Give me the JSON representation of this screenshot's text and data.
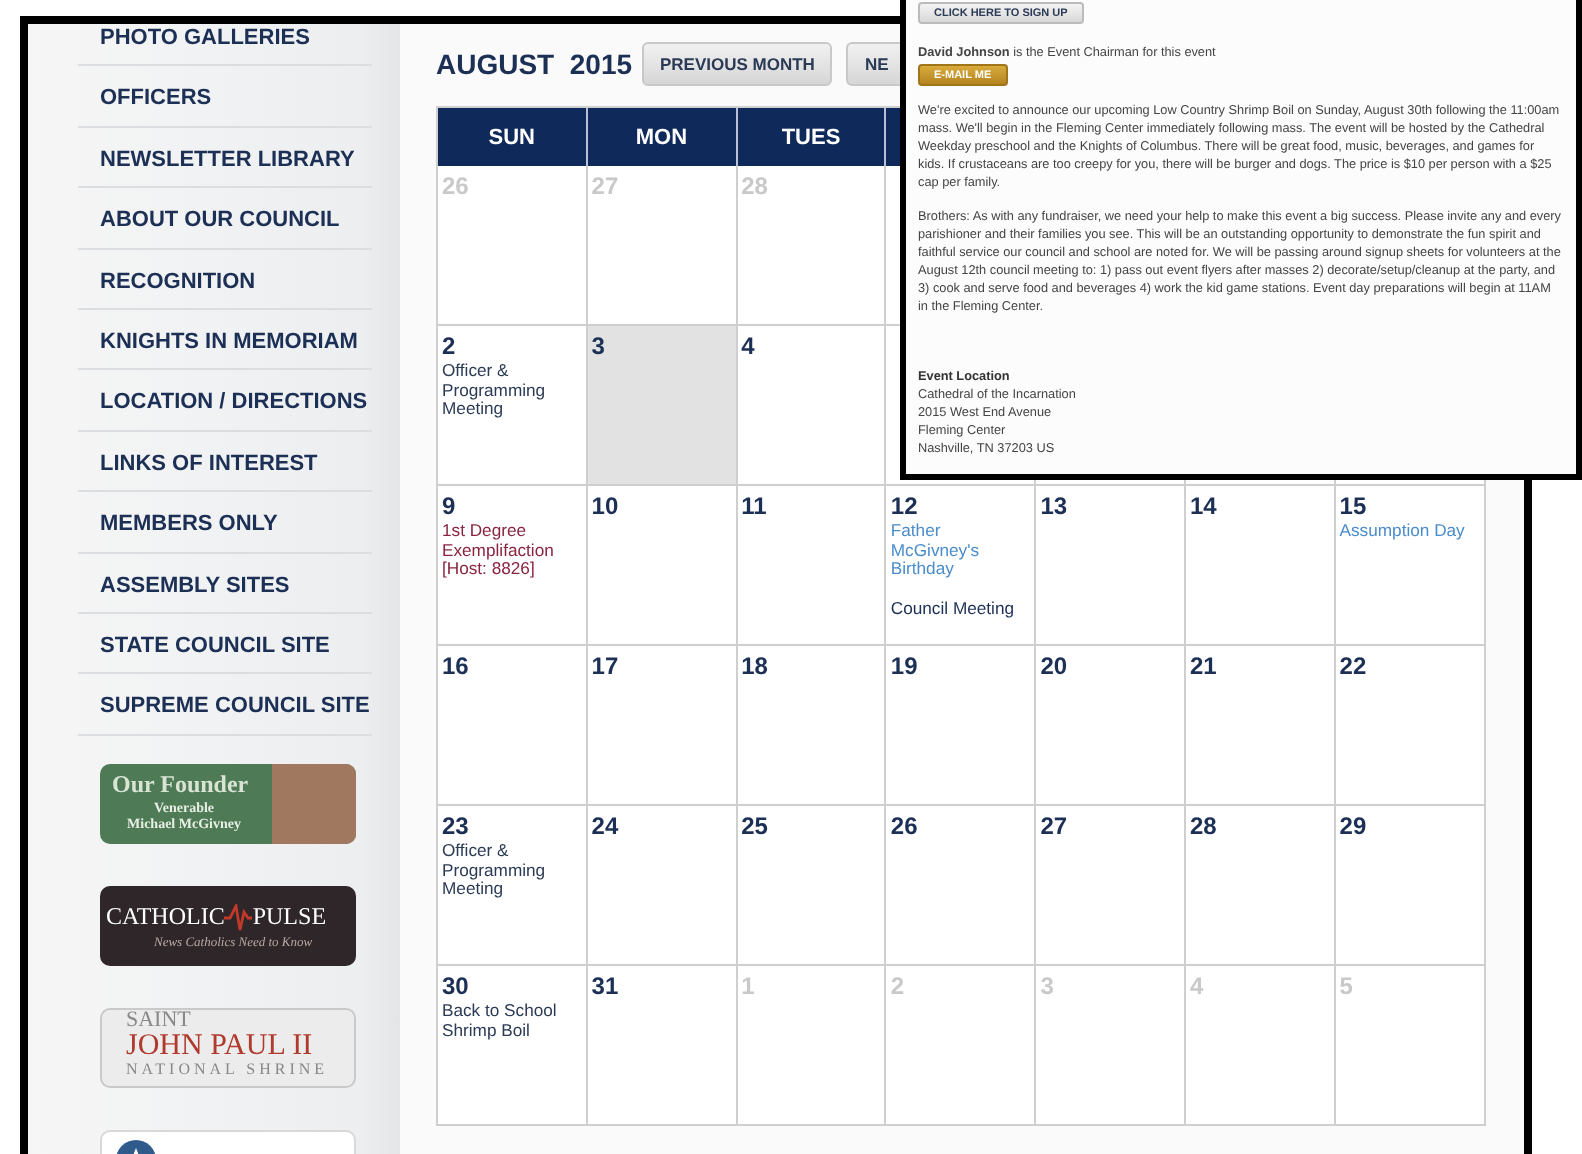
{
  "sidebar": {
    "items": [
      {
        "label": "PHOTO GALLERIES"
      },
      {
        "label": "OFFICERS"
      },
      {
        "label": "NEWSLETTER LIBRARY"
      },
      {
        "label": "ABOUT OUR COUNCIL"
      },
      {
        "label": "RECOGNITION"
      },
      {
        "label": "KNIGHTS IN MEMORIAM"
      },
      {
        "label": "LOCATION / DIRECTIONS"
      },
      {
        "label": "LINKS OF INTEREST"
      },
      {
        "label": "MEMBERS ONLY"
      },
      {
        "label": "ASSEMBLY SITES"
      },
      {
        "label": "STATE COUNCIL SITE"
      },
      {
        "label": "SUPREME COUNCIL SITE"
      }
    ],
    "banners": [
      {
        "kind": "founder",
        "title": "Our Founder",
        "lines": [
          "Venerable",
          "Michael McGivney"
        ]
      },
      {
        "kind": "pulse",
        "title": "CATHOLIC",
        "title_2": "PULSE",
        "lines": [
          "News Catholics Need to Know"
        ]
      },
      {
        "kind": "shrine",
        "title": "SAINT",
        "title_2": "JOHN PAUL II",
        "lines": [
          "NATIONAL SHRINE"
        ]
      },
      {
        "kind": "fathers"
      }
    ]
  },
  "calendar": {
    "title": "AUGUST  2015",
    "buttons": [
      {
        "label": "PREVIOUS MONTH"
      },
      {
        "label": "NE"
      }
    ],
    "weekdays": [
      "SUN",
      "MON",
      "TUES"
    ],
    "weeks": [
      {
        "days": [
          {
            "number": "26",
            "other_month": true,
            "highlighted": false
          },
          {
            "number": "27",
            "other_month": true,
            "highlighted": false
          },
          {
            "number": "28",
            "other_month": true,
            "highlighted": false
          }
        ]
      },
      {
        "days": [
          {
            "number": "2",
            "other_month": false,
            "highlighted": false,
            "events": [
              {
                "text": "Officer & Programming Meeting",
                "color": "#2b3a55"
              }
            ]
          },
          {
            "number": "3",
            "other_month": false,
            "highlighted": true
          },
          {
            "number": "4",
            "other_month": false,
            "highlighted": false
          }
        ]
      },
      {
        "days": [
          {
            "number": "9",
            "other_month": false,
            "highlighted": false,
            "events": [
              {
                "text": "1st Degree Exemplifaction [Host: 8826]",
                "color": "#8a2440"
              }
            ]
          },
          {
            "number": "10",
            "other_month": false,
            "highlighted": false
          },
          {
            "number": "11",
            "other_month": false,
            "highlighted": false
          },
          {
            "number": "12",
            "other_month": false,
            "highlighted": false,
            "events": [
              {
                "text": "Father McGivney's Birthday",
                "color": "#4a8ccc"
              },
              {
                "text": "Council Meeting",
                "color": "#1c2f55"
              }
            ]
          },
          {
            "number": "13",
            "other_month": false,
            "highlighted": false
          },
          {
            "number": "14",
            "other_month": false,
            "highlighted": false
          },
          {
            "number": "15",
            "other_month": false,
            "highlighted": false,
            "events": [
              {
                "text": "Assumption Day",
                "color": "#4a8ccc"
              }
            ]
          }
        ]
      },
      {
        "days": [
          {
            "number": "16",
            "other_month": false,
            "highlighted": false
          },
          {
            "number": "17",
            "other_month": false,
            "highlighted": false
          },
          {
            "number": "18",
            "other_month": false,
            "highlighted": false
          },
          {
            "number": "19",
            "other_month": false,
            "highlighted": false
          },
          {
            "number": "20",
            "other_month": false,
            "highlighted": false
          },
          {
            "number": "21",
            "other_month": false,
            "highlighted": false
          },
          {
            "number": "22",
            "other_month": false,
            "highlighted": false
          }
        ]
      },
      {
        "days": [
          {
            "number": "23",
            "other_month": false,
            "highlighted": false,
            "events": [
              {
                "text": "Officer & Programming Meeting",
                "color": "#2b3a55"
              }
            ]
          },
          {
            "number": "24",
            "other_month": false,
            "highlighted": false
          },
          {
            "number": "25",
            "other_month": false,
            "highlighted": false
          },
          {
            "number": "26",
            "other_month": false,
            "highlighted": false
          },
          {
            "number": "27",
            "other_month": false,
            "highlighted": false
          },
          {
            "number": "28",
            "other_month": false,
            "highlighted": false
          },
          {
            "number": "29",
            "other_month": false,
            "highlighted": false
          }
        ]
      },
      {
        "days": [
          {
            "number": "30",
            "other_month": false,
            "highlighted": false,
            "events": [
              {
                "text": "Back to School Shrimp Boil",
                "color": "#2b3a55"
              }
            ]
          },
          {
            "number": "31",
            "other_month": false,
            "highlighted": false
          },
          {
            "number": "1",
            "other_month": true,
            "highlighted": false
          },
          {
            "number": "2",
            "other_month": true,
            "highlighted": false
          },
          {
            "number": "3",
            "other_month": true,
            "highlighted": false
          },
          {
            "number": "4",
            "other_month": true,
            "highlighted": false
          },
          {
            "number": "5",
            "other_month": true,
            "highlighted": false
          }
        ]
      }
    ]
  },
  "event_popup": {
    "signup_button": "CLICK HERE TO SIGN UP",
    "chairman": "**David Johnson** is the Event Chairman for this event",
    "email_button": "E-MAIL ME",
    "paragraphs": [
      "We're excited to announce our upcoming Low Country Shrimp Boil on Sunday, August 30th following the 11:00am mass. We'll begin in the Fleming Center immediately following mass. The event will be hosted by the Cathedral Weekday preschool and the Knights of Columbus. There will be great food, music, beverages, and games for kids. If crustaceans are too creepy for you, there will be burger and dogs. The price is $10 per person with a $25 cap per family.",
      "Brothers: As with any fundraiser, we need your help to make this event a big success. Please invite any and every parishioner and their families you see. This will be an outstanding opportunity to demonstrate the fun spirit and faithful service our council and school are noted for. We will be passing around signup sheets for volunteers at the August 12th council meeting to: 1) pass out event flyers after masses 2) decorate/setup/cleanup at the party, and 3) cook and serve food and beverages 4) work the kid game stations. Event day preparations will begin at 11AM in the Fleming Center."
    ],
    "location_heading": "Event Location",
    "location_lines": [
      "Cathedral of the Incarnation",
      "2015 West End Avenue",
      "Fleming Center",
      "Nashville, TN  37203 US"
    ]
  }
}
